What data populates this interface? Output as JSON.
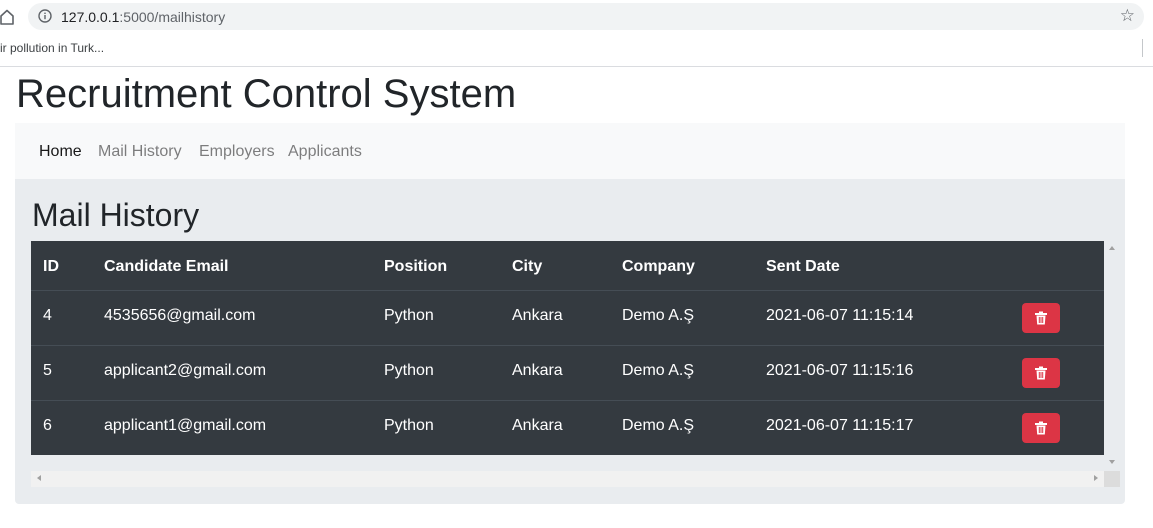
{
  "browser": {
    "url_host": "127.0.0.1",
    "url_path": ":5000/mailhistory",
    "bookmark": "ir pollution in Turk..."
  },
  "app": {
    "title": "Recruitment Control System"
  },
  "nav": {
    "items": [
      {
        "label": "Home",
        "active": true
      },
      {
        "label": "Mail History",
        "active": false
      },
      {
        "label": "Employers",
        "active": false
      },
      {
        "label": "Applicants",
        "active": false
      }
    ]
  },
  "main": {
    "heading": "Mail History",
    "table": {
      "headers": [
        "ID",
        "Candidate Email",
        "Position",
        "City",
        "Company",
        "Sent Date"
      ],
      "rows": [
        [
          "4",
          "4535656@gmail.com",
          "Python",
          "Ankara",
          "Demo A.Ş",
          "2021-06-07 11:15:14"
        ],
        [
          "5",
          "applicant2@gmail.com",
          "Python",
          "Ankara",
          "Demo A.Ş",
          "2021-06-07 11:15:16"
        ],
        [
          "6",
          "applicant1@gmail.com",
          "Python",
          "Ankara",
          "Demo A.Ş",
          "2021-06-07 11:15:17"
        ]
      ]
    }
  },
  "icons": {
    "home": "home-icon",
    "info": "info-icon",
    "bookmark_star": "star-icon",
    "delete": "trash-icon"
  },
  "colors": {
    "table_bg": "#343a40",
    "danger": "#dc3545",
    "navbar_bg": "#f8f9fa",
    "panel_bg": "#e9ecef"
  }
}
